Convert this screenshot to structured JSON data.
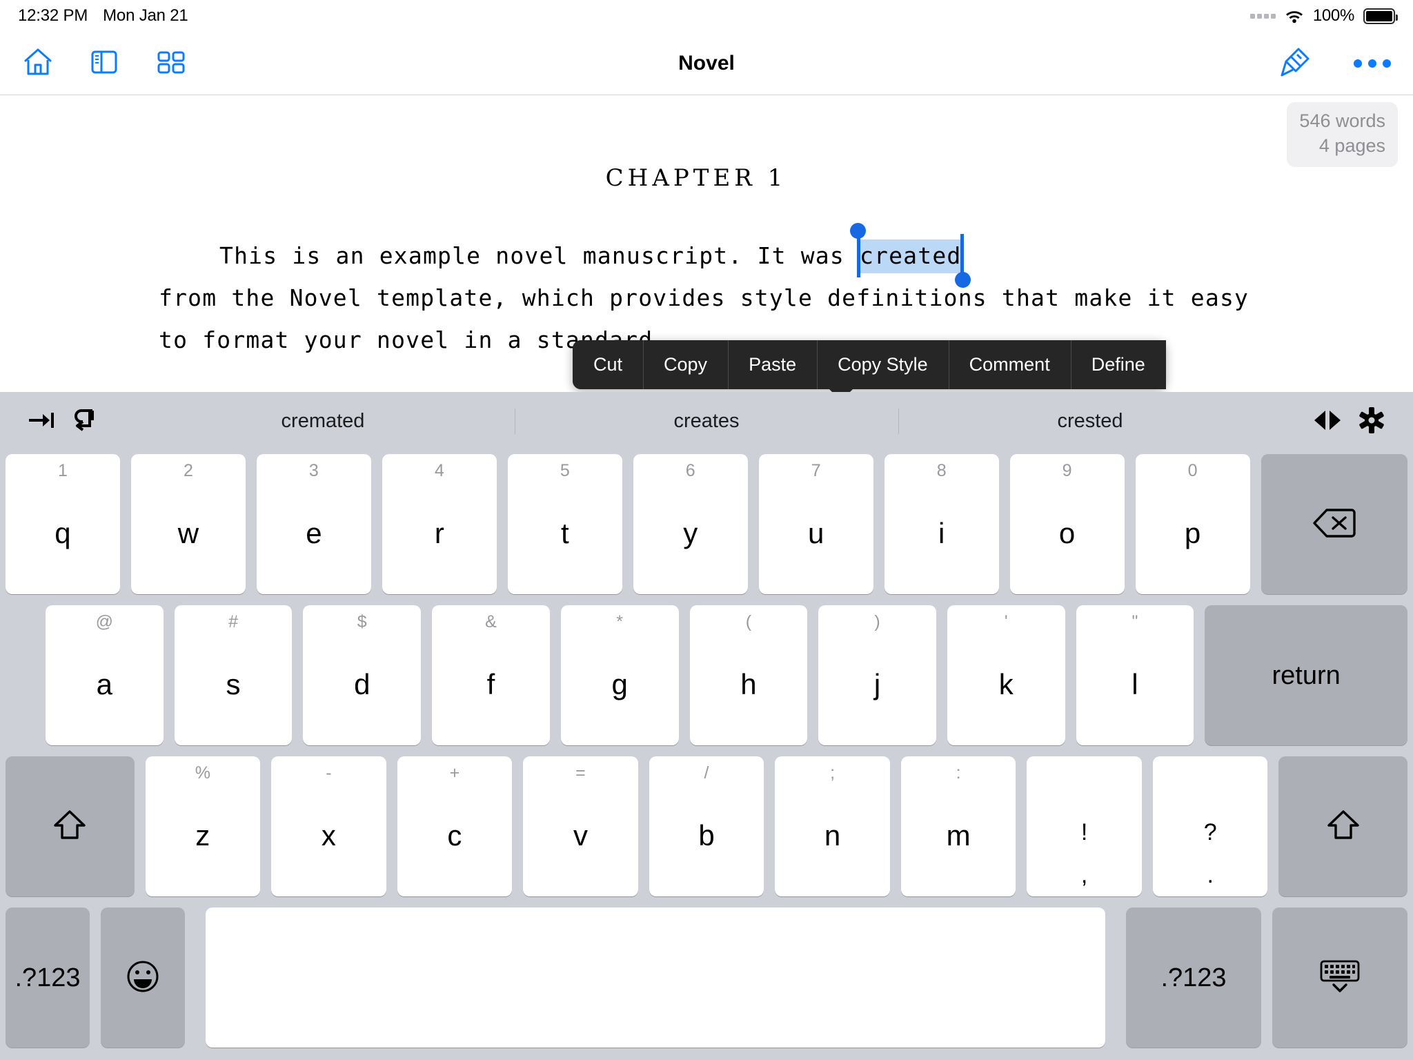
{
  "status_bar": {
    "time": "12:32 PM",
    "date": "Mon Jan 21",
    "battery_percent": "100%"
  },
  "toolbar": {
    "title": "Novel",
    "home_icon": "home-icon",
    "sidebar_icon": "sidebar-icon",
    "grid_icon": "grid-icon",
    "format_icon": "paintbrush-icon",
    "more_icon": "ellipsis-icon"
  },
  "document": {
    "word_count": "546 words",
    "page_count": "4 pages",
    "chapter_heading": "CHAPTER 1",
    "paragraph_before": "This is an example novel manuscript. It was ",
    "selected_text": "created",
    "paragraph_after": "from the Novel template, which provides style definitions that make it easy to format your novel in a standard"
  },
  "context_menu": {
    "items": [
      {
        "label": "Cut"
      },
      {
        "label": "Copy"
      },
      {
        "label": "Paste"
      },
      {
        "label": "Copy Style"
      },
      {
        "label": "Comment"
      },
      {
        "label": "Define"
      }
    ]
  },
  "keyboard": {
    "suggestions": [
      {
        "label": "cremated"
      },
      {
        "label": "creates"
      },
      {
        "label": "crested"
      }
    ],
    "tab_icon": "tab-icon",
    "undo_icon": "undo-icon",
    "arrows_icon": "left-right-arrows-icon",
    "settings_icon": "gear-icon",
    "row1": [
      {
        "alt": "1",
        "main": "q"
      },
      {
        "alt": "2",
        "main": "w"
      },
      {
        "alt": "3",
        "main": "e"
      },
      {
        "alt": "4",
        "main": "r"
      },
      {
        "alt": "5",
        "main": "t"
      },
      {
        "alt": "6",
        "main": "y"
      },
      {
        "alt": "7",
        "main": "u"
      },
      {
        "alt": "8",
        "main": "i"
      },
      {
        "alt": "9",
        "main": "o"
      },
      {
        "alt": "0",
        "main": "p"
      }
    ],
    "backspace_icon": "backspace-icon",
    "row2": [
      {
        "alt": "@",
        "main": "a"
      },
      {
        "alt": "#",
        "main": "s"
      },
      {
        "alt": "$",
        "main": "d"
      },
      {
        "alt": "&",
        "main": "f"
      },
      {
        "alt": "*",
        "main": "g"
      },
      {
        "alt": "(",
        "main": "h"
      },
      {
        "alt": ")",
        "main": "j"
      },
      {
        "alt": "'",
        "main": "k"
      },
      {
        "alt": "\"",
        "main": "l"
      }
    ],
    "return_label": "return",
    "shift_icon": "shift-icon",
    "row3": [
      {
        "alt": "%",
        "main": "z"
      },
      {
        "alt": "-",
        "main": "x"
      },
      {
        "alt": "+",
        "main": "c"
      },
      {
        "alt": "=",
        "main": "v"
      },
      {
        "alt": "/",
        "main": "b"
      },
      {
        "alt": ";",
        "main": "n"
      },
      {
        "alt": ":",
        "main": "m"
      }
    ],
    "punct1": {
      "main": "!",
      "sub": ","
    },
    "punct2": {
      "main": "?",
      "sub": "."
    },
    "shift_right_icon": "shift-icon",
    "num_left_label": ".?123",
    "emoji_icon": "emoji-icon",
    "space_label": "",
    "num_right_label": ".?123",
    "hide_keyboard_icon": "hide-keyboard-icon"
  },
  "colors": {
    "accent_blue": "#0a7cff",
    "selection_handle": "#1668e3",
    "selection_fill": "#bcd8f7",
    "menu_bg": "#262626",
    "keyboard_bg": "#cdd0d6"
  }
}
